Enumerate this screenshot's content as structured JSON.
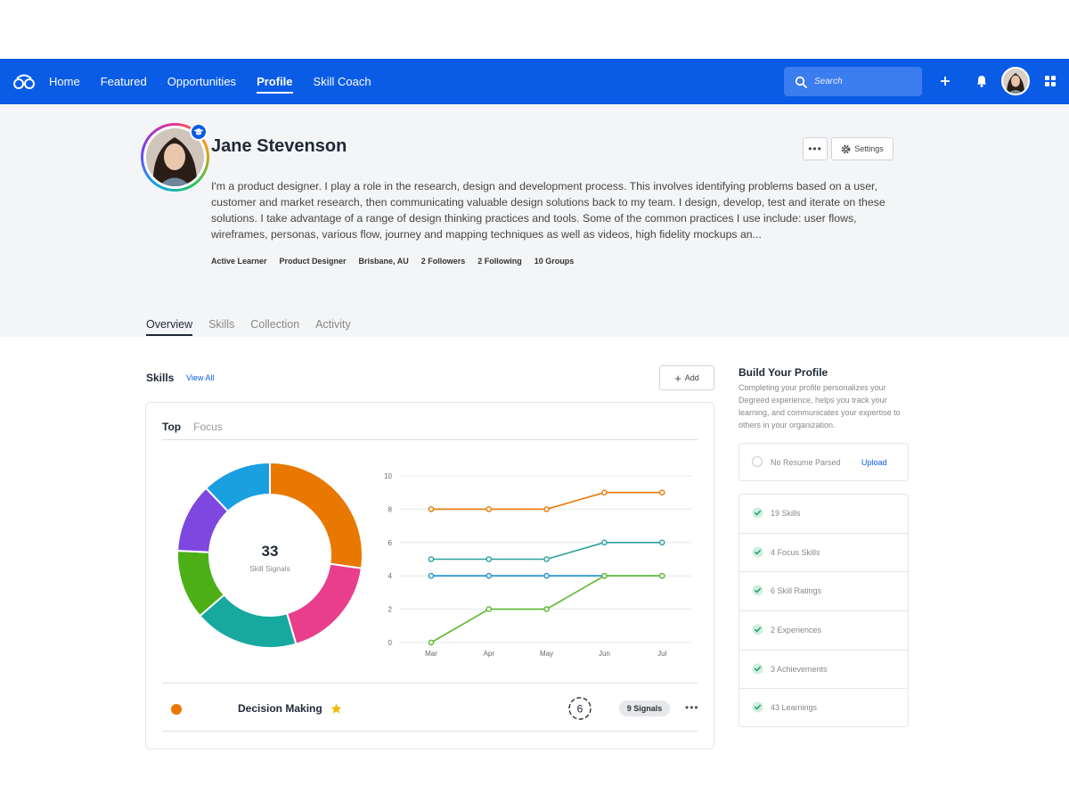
{
  "nav": {
    "items": [
      "Home",
      "Featured",
      "Opportunities",
      "Profile",
      "Skill Coach"
    ],
    "active": "Profile",
    "search_placeholder": "Search"
  },
  "profile": {
    "name": "Jane Stevenson",
    "bio": "I'm a product designer. I play a role in the research, design and development process. This involves identifying problems based on a user, customer and market research, then communicating valuable design solutions back to my team. I design, develop, test and iterate on these solutions. I take advantage of a range of design thinking practices and tools. Some of the common practices I use include: user flows, wireframes, personas, various flow, journey and mapping techniques as well as videos, high fidelity mockups an...",
    "meta": [
      "Active Learner",
      "Product Designer",
      "Brisbane, AU",
      "2 Followers",
      "2 Following",
      "10 Groups"
    ],
    "settings_label": "Settings",
    "more_label": "•••"
  },
  "tabs": [
    "Overview",
    "Skills",
    "Collection",
    "Activity"
  ],
  "skills": {
    "title": "Skills",
    "view_all": "View All",
    "add_label": "Add",
    "card_tabs": [
      "Top",
      "Focus"
    ],
    "top_skill": {
      "name": "Decision Making",
      "rating": "6",
      "signals": "9 Signals",
      "color": "#e87800"
    }
  },
  "chart_data": [
    {
      "type": "pie",
      "center_value": "33",
      "center_label": "Skill Signals",
      "slices": [
        {
          "value": 9,
          "color": "#e87800"
        },
        {
          "value": 6,
          "color": "#e83e8c"
        },
        {
          "value": 6,
          "color": "#17a8a0"
        },
        {
          "value": 4,
          "color": "#4caf16"
        },
        {
          "value": 4,
          "color": "#7e47e0"
        },
        {
          "value": 4,
          "color": "#1a9fe0"
        }
      ]
    },
    {
      "type": "line",
      "x": [
        "Mar",
        "Apr",
        "May",
        "Jun",
        "Jul"
      ],
      "ylim": [
        0,
        10
      ],
      "yticks": [
        0,
        2,
        4,
        6,
        8,
        10
      ],
      "series": [
        {
          "values": [
            8,
            8,
            8,
            9,
            9
          ],
          "color": "#e87800"
        },
        {
          "values": [
            5,
            5,
            5,
            6,
            6
          ],
          "color": "#2aa0a0"
        },
        {
          "values": [
            4,
            4,
            4,
            4,
            4
          ],
          "color": "#1a8fd0"
        },
        {
          "values": [
            0,
            2,
            2,
            4,
            4
          ],
          "color": "#5cb82e"
        }
      ]
    }
  ],
  "build_profile": {
    "title": "Build Your Profile",
    "description": "Completing your profile personalizes your Degreed experience, helps you track your learning, and communicates your expertise to others in your organization.",
    "resume_text": "No Resume Parsed",
    "upload_label": "Upload",
    "checklist": [
      "19 Skills",
      "4 Focus Skills",
      "6 Skill Ratings",
      "2 Experiences",
      "3 Achievements",
      "43 Learnings"
    ]
  }
}
